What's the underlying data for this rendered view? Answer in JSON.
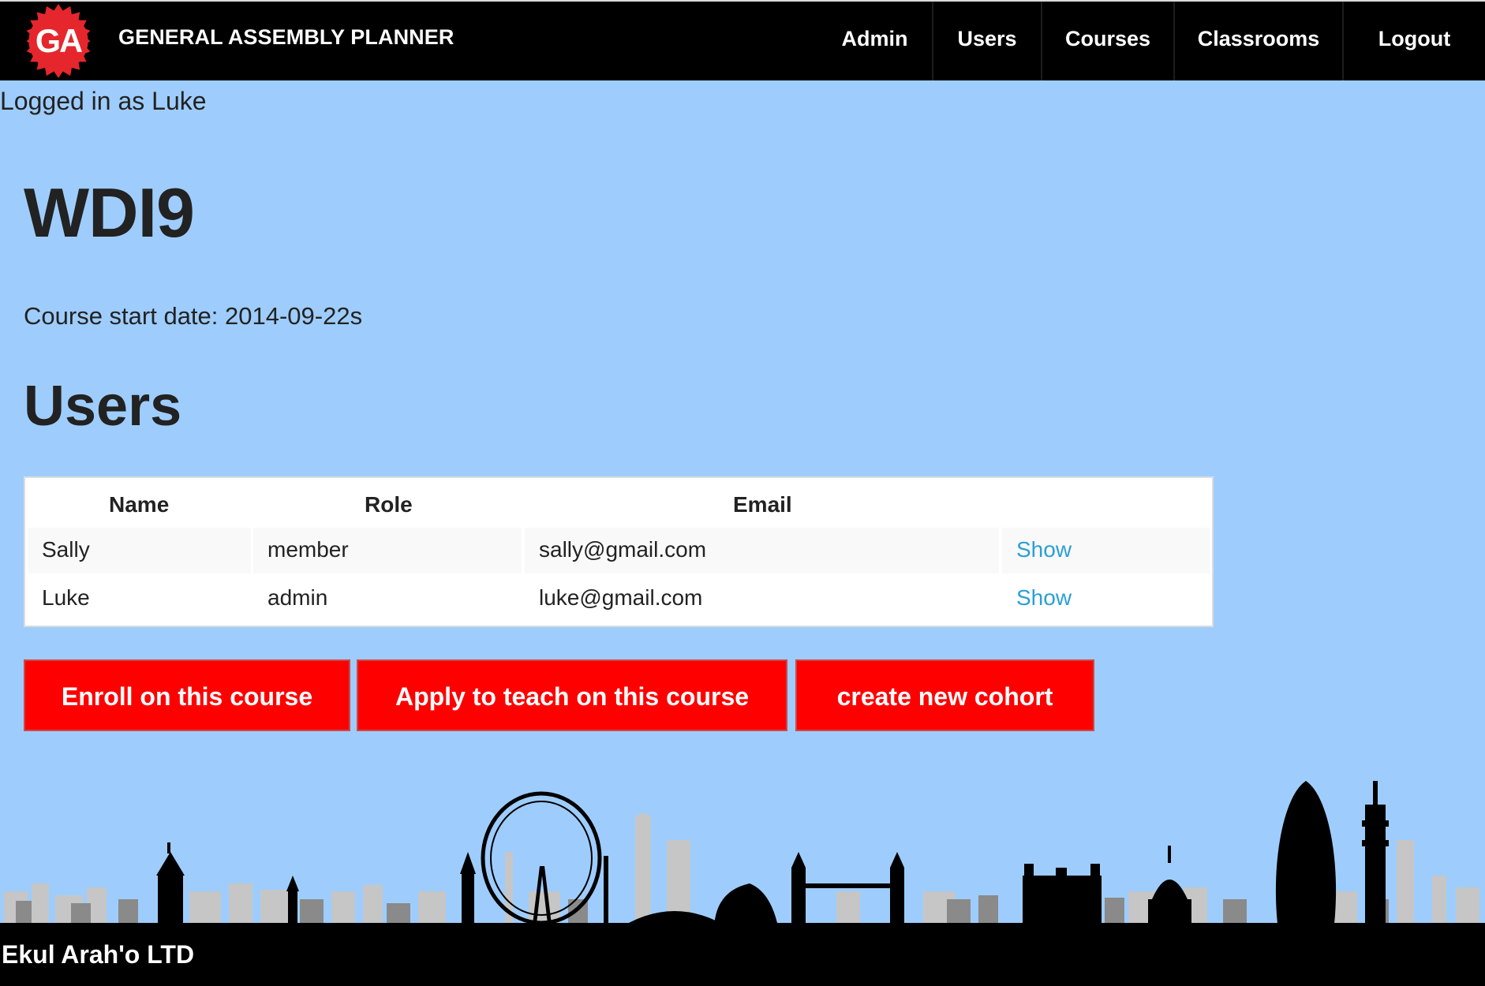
{
  "header": {
    "logo_text": "GA",
    "brand": "GENERAL ASSEMBLY PLANNER",
    "nav": [
      {
        "label": "Admin"
      },
      {
        "label": "Users"
      },
      {
        "label": "Courses"
      },
      {
        "label": "Classrooms"
      },
      {
        "label": "Logout"
      }
    ]
  },
  "session": {
    "logged_in_text": "Logged in as Luke"
  },
  "course": {
    "title": "WDI9",
    "start_date_text": "Course start date: 2014-09-22s"
  },
  "users_section": {
    "heading": "Users",
    "columns": [
      "Name",
      "Role",
      "Email"
    ],
    "rows": [
      {
        "name": "Sally",
        "role": "member",
        "email": "sally@gmail.com",
        "action": "Show"
      },
      {
        "name": "Luke",
        "role": "admin",
        "email": "luke@gmail.com",
        "action": "Show"
      }
    ]
  },
  "actions": {
    "enroll": "Enroll on this course",
    "apply_teach": "Apply to teach on this course",
    "create_cohort": "create new cohort"
  },
  "footer": {
    "text": "Ekul Arah'o LTD"
  },
  "colors": {
    "background": "#9ecdfd",
    "topbar": "#000000",
    "button": "#ff0000",
    "link": "#2a9fd6",
    "logo_red": "#e5272d"
  }
}
